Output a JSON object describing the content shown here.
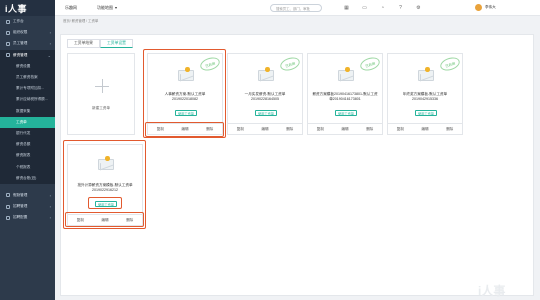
{
  "brand": {
    "logo": "i人事"
  },
  "topbar": {
    "app_name": "乐趣网",
    "menu_label": "功能地图",
    "menu_caret": "▾",
    "search_placeholder": "搜索员工、部门、审批",
    "icons": [
      "grid-icon",
      "message-icon",
      "bell-icon",
      "help-icon",
      "settings-icon"
    ],
    "user_name": "李伟大"
  },
  "sidebar": {
    "items": [
      {
        "label": "工作台"
      },
      {
        "label": "组织权限"
      },
      {
        "label": "员工管理"
      },
      {
        "label": "薪资管理"
      }
    ],
    "sub_items": [
      {
        "label": "薪资设置"
      },
      {
        "label": "员工薪资档案"
      },
      {
        "label": "累计专项附加扣..."
      },
      {
        "label": "累计应纳税所得额..."
      },
      {
        "label": "数据采集"
      },
      {
        "label": "工资单"
      },
      {
        "label": "银行代发"
      },
      {
        "label": "薪资总额"
      },
      {
        "label": "薪资报表"
      },
      {
        "label": "个税报表"
      },
      {
        "label": "薪资台账(旧)"
      }
    ],
    "bottom_items": [
      {
        "label": "假勤管理"
      },
      {
        "label": "招聘管理"
      },
      {
        "label": "招聘配置"
      }
    ],
    "active_sub": "工资单"
  },
  "breadcrumb": "首页/ 薪资管理 / 工资单",
  "tabs": [
    {
      "label": "工资单结果",
      "active": false
    },
    {
      "label": "工资单设置",
      "active": true
    }
  ],
  "add_card": {
    "label": "新建工资单"
  },
  "cards": [
    {
      "title": "人事薪资方案-默认工资单2019022018082",
      "use_label": "使用工资单",
      "stamp": "已启用",
      "actions": [
        "复制",
        "编辑",
        "删除"
      ]
    },
    {
      "title": "一月实发薪资-默认工资单20190228164505",
      "use_label": "使用工资单",
      "stamp": "已启用",
      "actions": [
        "复制",
        "编辑",
        "删除"
      ]
    },
    {
      "title": "薪资方案模板20190416173801-默认工资单20190416173801",
      "use_label": "使用工资单",
      "stamp": "已启用",
      "actions": [
        "复制",
        "编辑",
        "删除"
      ]
    },
    {
      "title": "年终奖方案模板-默认工资单2019042915336",
      "use_label": "使用工资单",
      "stamp": "已启用",
      "actions": [
        "复制",
        "编辑",
        "删除"
      ]
    },
    {
      "title": "批外计算薪资方案模板-默认工资单2019022916212",
      "use_label": "使用工资单",
      "stamp": "",
      "actions": [
        "复制",
        "编辑",
        "删除"
      ]
    }
  ],
  "highlight_color": "#e25a2f",
  "accent_color": "#24b39b",
  "watermark": "i人事"
}
